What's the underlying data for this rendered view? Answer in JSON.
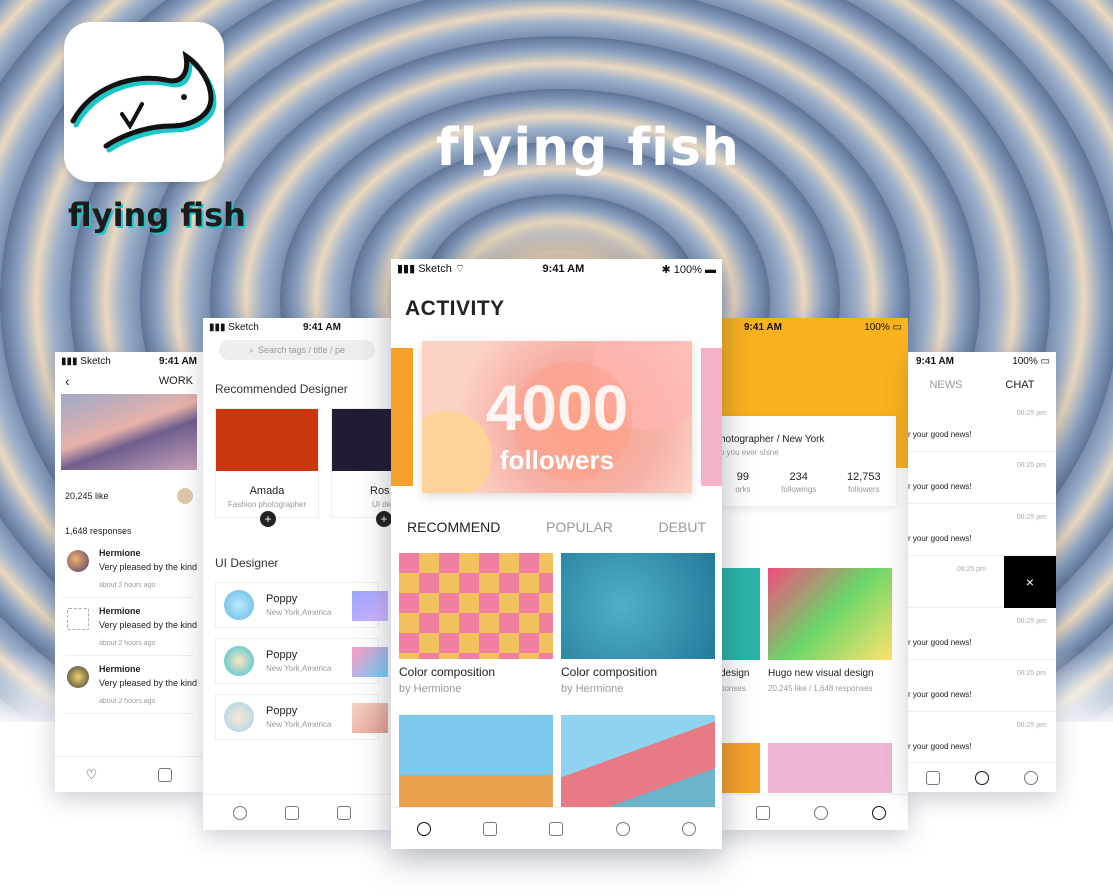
{
  "brand": {
    "name": "flying fish",
    "hero_title": "flying fish"
  },
  "colors": {
    "accent": "#19c7c9",
    "orange": "#fbb21f"
  },
  "status_bar": {
    "carrier": "Sketch",
    "time": "9:41 AM",
    "battery": "100%"
  },
  "work_screen": {
    "title": "WORK",
    "likes": "20,245 like",
    "responses": "1,648 responses",
    "comments": [
      {
        "name": "Hermione",
        "text": "Very pleased by the kind",
        "time": "about 2 hours ago"
      },
      {
        "name": "Hermione",
        "text": "Very pleased by the kind",
        "time": "about 2 hours ago"
      },
      {
        "name": "Hermione",
        "text": "Very pleased by the kind",
        "time": "about 2 hours ago"
      }
    ]
  },
  "discover_screen": {
    "search_placeholder": "Search tags / title / pe",
    "recommended_heading": "Recommended Designer",
    "designers": [
      {
        "name": "Amada",
        "role": "Fashion photographer"
      },
      {
        "name": "Ros",
        "role": "UI desig"
      }
    ],
    "ui_heading": "UI Designer",
    "ui_designers": [
      {
        "name": "Poppy",
        "location": "New York,America"
      },
      {
        "name": "Poppy",
        "location": "New York,America"
      },
      {
        "name": "Poppy",
        "location": "New York,America"
      }
    ]
  },
  "activity_screen": {
    "title": "ACTIVITY",
    "banner_number": "4000",
    "banner_label": "followers",
    "tabs": [
      "RECOMMEND",
      "POPULAR",
      "DEBUT"
    ],
    "cards": [
      {
        "title": "Color composition",
        "author": "by Hermione"
      },
      {
        "title": "Color composition",
        "author": "by Hermione"
      }
    ]
  },
  "profile_screen": {
    "title": "hotographer / New York",
    "subtitle": "o you ever shine",
    "stats": [
      {
        "value": "99",
        "label": "orks"
      },
      {
        "value": "234",
        "label": "followings"
      },
      {
        "value": "12,753",
        "label": "followers"
      }
    ],
    "works": [
      {
        "title": "design",
        "meta": "ponses"
      },
      {
        "title": "Hugo new visual design",
        "meta": "20,245 like / 1,648 responses"
      }
    ]
  },
  "messages_screen": {
    "tabs": [
      "NEWS",
      "CHAT"
    ],
    "messages": [
      {
        "text": "r your good news!",
        "time": "06:25 pm"
      },
      {
        "text": "r your good news!",
        "time": "06:25 pm"
      },
      {
        "text": "r your good news!",
        "time": "06:25 pm"
      },
      {
        "text": "",
        "time": "06:25 pm",
        "swiped": true,
        "action": "×"
      },
      {
        "text": "r your good news!",
        "time": "06:25 pm"
      },
      {
        "text": "r your good news!",
        "time": "06:25 pm"
      },
      {
        "text": "r your good news!",
        "time": "06:25 pm"
      }
    ]
  }
}
